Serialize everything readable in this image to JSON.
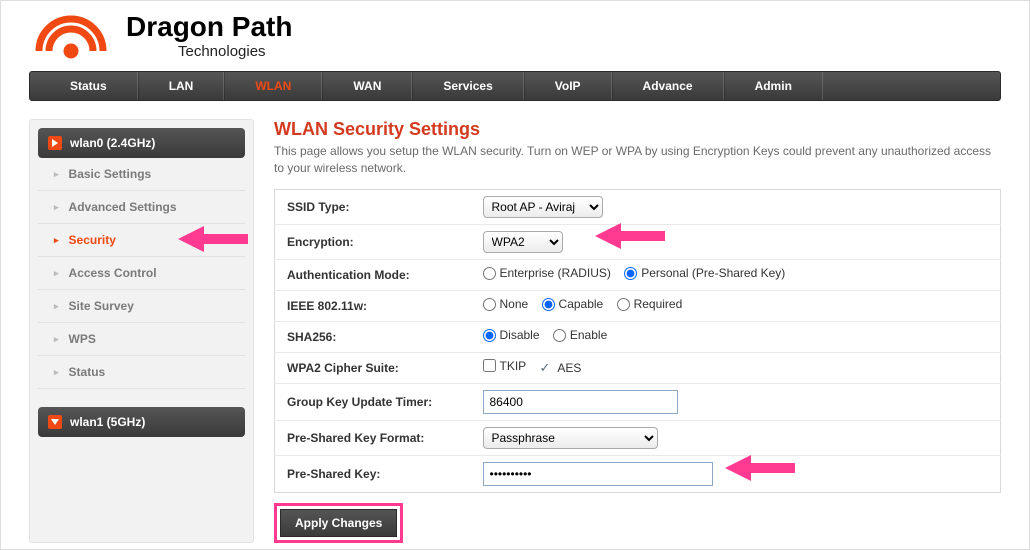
{
  "brand": {
    "title": "Dragon Path",
    "subtitle": "Technologies"
  },
  "topnav": [
    {
      "label": "Status",
      "active": false
    },
    {
      "label": "LAN",
      "active": false
    },
    {
      "label": "WLAN",
      "active": true
    },
    {
      "label": "WAN",
      "active": false
    },
    {
      "label": "Services",
      "active": false
    },
    {
      "label": "VoIP",
      "active": false
    },
    {
      "label": "Advance",
      "active": false
    },
    {
      "label": "Admin",
      "active": false
    }
  ],
  "sidebar": {
    "groups": [
      {
        "head": "wlan0 (2.4GHz)",
        "items": [
          {
            "label": "Basic Settings",
            "active": false
          },
          {
            "label": "Advanced Settings",
            "active": false
          },
          {
            "label": "Security",
            "active": true
          },
          {
            "label": "Access Control",
            "active": false
          },
          {
            "label": "Site Survey",
            "active": false
          },
          {
            "label": "WPS",
            "active": false
          },
          {
            "label": "Status",
            "active": false
          }
        ]
      },
      {
        "head": "wlan1 (5GHz)",
        "items": []
      }
    ]
  },
  "page": {
    "title": "WLAN Security Settings",
    "desc": "This page allows you setup the WLAN security. Turn on WEP or WPA by using Encryption Keys could prevent any unauthorized access to your wireless network."
  },
  "form": {
    "ssid_type": {
      "label": "SSID Type:",
      "value": "Root AP - Aviraj"
    },
    "encryption": {
      "label": "Encryption:",
      "value": "WPA2"
    },
    "auth_mode": {
      "label": "Authentication Mode:",
      "options": [
        {
          "label": "Enterprise (RADIUS)",
          "checked": false
        },
        {
          "label": "Personal (Pre-Shared Key)",
          "checked": true
        }
      ]
    },
    "ieee80211w": {
      "label": "IEEE 802.11w:",
      "options": [
        {
          "label": "None",
          "checked": false
        },
        {
          "label": "Capable",
          "checked": true
        },
        {
          "label": "Required",
          "checked": false
        }
      ]
    },
    "sha256": {
      "label": "SHA256:",
      "options": [
        {
          "label": "Disable",
          "checked": true
        },
        {
          "label": "Enable",
          "checked": false
        }
      ]
    },
    "cipher": {
      "label": "WPA2 Cipher Suite:",
      "options": [
        {
          "label": "TKIP",
          "checked": false
        },
        {
          "label": "AES",
          "checked": true
        }
      ]
    },
    "group_key": {
      "label": "Group Key Update Timer:",
      "value": "86400"
    },
    "psk_format": {
      "label": "Pre-Shared Key Format:",
      "value": "Passphrase"
    },
    "psk": {
      "label": "Pre-Shared Key:",
      "value": "••••••••••"
    },
    "apply": "Apply Changes"
  },
  "accent": {
    "brand": "#f04913",
    "pink": "#ff3a90"
  }
}
